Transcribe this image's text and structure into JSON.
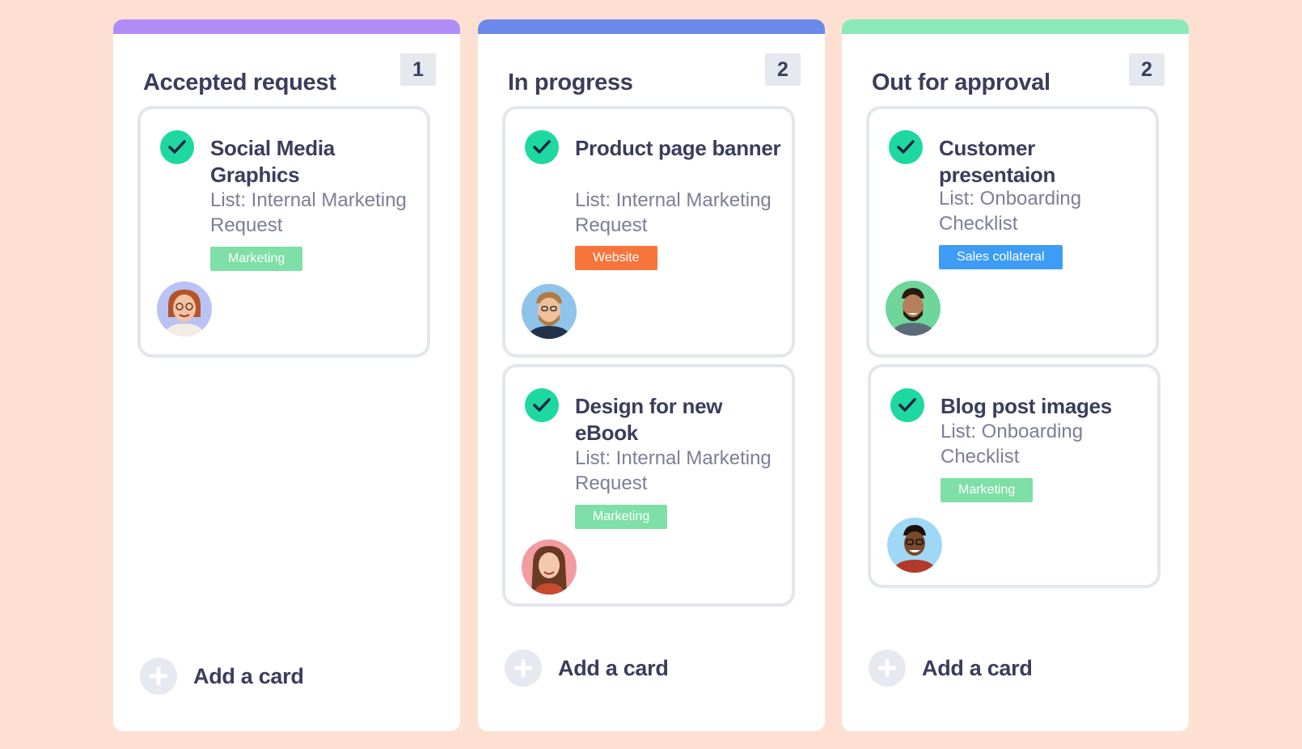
{
  "colors": {
    "background": "#fde0d2",
    "accepted_bar": "#b08cf6",
    "progress_bar": "#6b89ea",
    "approval_bar": "#8be9b8",
    "check": "#1dd8a0",
    "tag_marketing": "#7ee0a6",
    "tag_website": "#f7743b",
    "tag_sales": "#3d9cf5"
  },
  "columns": [
    {
      "title": "Accepted request",
      "count": "1",
      "add_label": "Add a card",
      "cards": [
        {
          "title": "Social Media Graphics",
          "list": "List: Internal Marketing Request",
          "tag": "Marketing",
          "icon": "check-circle-icon"
        }
      ]
    },
    {
      "title": "In progress",
      "count": "2",
      "add_label": "Add a card",
      "cards": [
        {
          "title": "Product page banner",
          "list": "List: Internal Marketing Request",
          "tag": "Website",
          "icon": "check-circle-icon"
        },
        {
          "title": "Design for new eBook",
          "list": "List: Internal Marketing Request",
          "tag": "Marketing",
          "icon": "check-circle-icon"
        }
      ]
    },
    {
      "title": "Out for approval",
      "count": "2",
      "add_label": "Add a card",
      "cards": [
        {
          "title": "Customer presentaion",
          "list": "List: Onboarding Checklist",
          "tag": "Sales collateral",
          "icon": "check-circle-icon"
        },
        {
          "title": "Blog post images",
          "list": "List: Onboarding Checklist",
          "tag": "Marketing",
          "icon": "check-circle-icon"
        }
      ]
    }
  ]
}
